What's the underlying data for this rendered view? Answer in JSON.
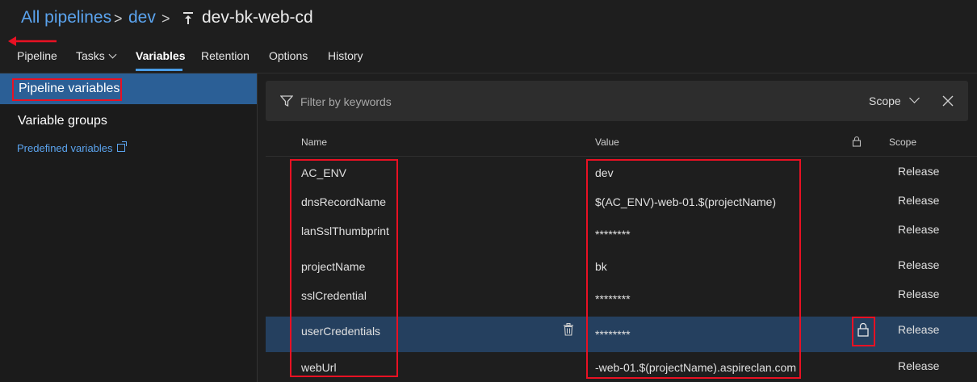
{
  "breadcrumb": {
    "root": "All pipelines",
    "folder": "dev",
    "pipeline": "dev-bk-web-cd"
  },
  "tabs": [
    "Pipeline",
    "Tasks",
    "Variables",
    "Retention",
    "Options",
    "History"
  ],
  "sidebar": {
    "items": [
      {
        "label": "Pipeline variables"
      },
      {
        "label": "Variable groups"
      },
      {
        "label": "Predefined variables"
      }
    ]
  },
  "filter": {
    "placeholder": "Filter by keywords",
    "scope_label": "Scope"
  },
  "table": {
    "headers": {
      "name": "Name",
      "value": "Value",
      "scope": "Scope"
    },
    "rows": [
      {
        "name": "AC_ENV",
        "value": "dev",
        "scope": "Release"
      },
      {
        "name": "dnsRecordName",
        "value": "$(AC_ENV)-web-01.$(projectName)",
        "scope": "Release"
      },
      {
        "name": "lanSslThumbprint",
        "value": "********",
        "scope": "Release"
      },
      {
        "name": "projectName",
        "value": "bk",
        "scope": "Release"
      },
      {
        "name": "sslCredential",
        "value": "********",
        "scope": "Release"
      },
      {
        "name": "userCredentials",
        "value": "********",
        "scope": "Release"
      },
      {
        "name": "webUrl",
        "value": "-web-01.$(projectName).aspireclan.com",
        "scope": "Release"
      }
    ]
  },
  "colors": {
    "accent": "#4a9de6",
    "link": "#5ba4ef",
    "highlight": "#e81123",
    "selected_row": "#25405f",
    "sidebar_active": "#2b5f96"
  }
}
